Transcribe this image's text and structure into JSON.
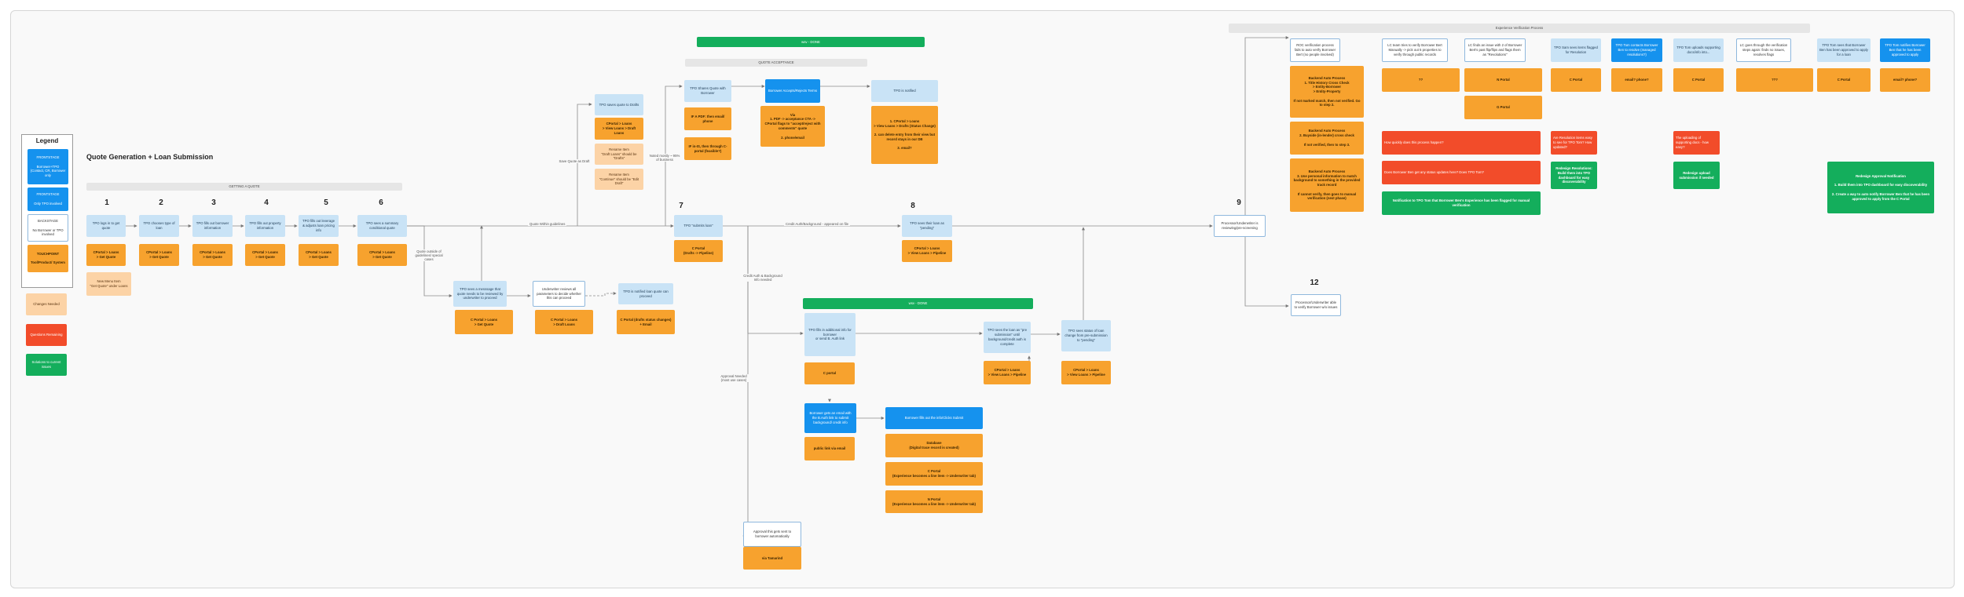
{
  "legend": {
    "title": "Legend",
    "items": [
      {
        "label": "FRONTSTAGE\n\nBorrower+TPO (Contact, CR, Borrower only"
      },
      {
        "label": "FRONTSTAGE\n\nOnly TPO involved"
      },
      {
        "label": "BACKSTAGE\n\nNo Borrower or TPO involved"
      },
      {
        "label": "TOUCHPOINT\n\nTool/Product/ System"
      },
      {
        "label": "Changes Needed"
      },
      {
        "label": "Questions Remaining"
      },
      {
        "label": "Solutions to current issues"
      }
    ]
  },
  "colors": {
    "frontstage_both": "#c9e3f6",
    "frontstage_tpo": "#1592ee",
    "touchpoint": "#f7a22e",
    "changes": "#fcd3a6",
    "questions": "#f24c2a",
    "solutions": "#14ae5c"
  },
  "page_title": "Quote Generation + Loan Submission",
  "sections": {
    "getting_quote": "GETTING A QUOTE",
    "quote_acceptance": "QUOTE ACCEPTANCE",
    "wsv_done_1": "wsv - DONE",
    "wsv_done_2": "wsv - DONE",
    "experience_verification": "Experience Verification Process"
  },
  "steps": {
    "s1": "1",
    "s2": "2",
    "s3": "3",
    "s4": "4",
    "s5": "5",
    "s6": "6",
    "s7": "7",
    "s8": "8",
    "s9": "9",
    "s12": "12"
  },
  "nodes": {
    "tpo_login": "TPO logs in to get quote",
    "tpo_loan_type": "TPO chooses type of loan",
    "tpo_borrower_info": "TPO fills out borrower information",
    "tpo_property_info": "TPO fills out property information",
    "tpo_leverage": "TPO fills out leverage & adjusts loan pricing info",
    "tpo_summary": "TPO sees a summary conditional quote",
    "t1": "CPortal > Loans\n> Get Quote",
    "t2": "CPortal > Loans\n> Get Quote",
    "t3": "CPortal > Loans\n> Get Quote",
    "t4": "CPortal > Loans\n> Get Quote",
    "t5": "CPortal > Loans\n> Get Quote",
    "t6": "CPortal > Loans\n> Get Quote",
    "new_menu": "New Menu Item\n\"Get Quote\" under Loans",
    "tpo_message": "TPO sees a messsage that quote needs to be reviewed by underwriter to proceed",
    "uw_review": "Underwriter reviews all parameters to decide whether this can proceed",
    "tpo_notified": "TPO is notified loan quote can proceed",
    "t_message": "C Portal > Loans\n> Get Quote",
    "t_uw": "C Portal > Loans\n> Draft Loans",
    "t_notified": "C Portal (drafts status changes) + Email",
    "tpo_saves_draft": "TPO saves quote to Drafts",
    "t_draft": "CPortal > Loans\n> View Loans > Draft Loans",
    "rename_drafts": "Rename Item\n\"Draft Loans\" should be \"Drafts\"",
    "rename_edit": "Rename Item\n\"Continue\" should be \"Edit Draft\"",
    "tpo_shares": "TPO Shares Quote with Borrower",
    "t_share_a": "IF A PDF: then email/ phone",
    "t_share_b": "IF in-IS, then through C-portal (feasible?)",
    "borrower_accepts": "Borrower Accepts/Rejects Terms",
    "t_accepts": "Via\n1. PDF -> acceptance CTA ->\nCPortal flags to \"accept/reject with comments\" quote\n\n2. phone/email",
    "tpo_notified_2": "TPO is notified",
    "t_notified_2": "1. CPortal > Loans\n> View Loans > Drafts (Status Change)\n\n2. can delete entry from their view but record stays in our DB\n\n3. email?",
    "tpo_submits": "TPO \"submits loan\"",
    "t_submits": "C Portal\n(Drafts -> Pipeline)",
    "tpo_sees_pending": "TPO sees their loan as \"pending\"",
    "t_pending": "CPortal > Loans\n> View Loans > Pipeline",
    "tpo_fills_additional": "TPO fills in additional info for borrower\nor send B. Auth link",
    "t_additional": "C portal",
    "borrower_email": "Borrower gets an email with the B.Auth link to submit background/ credit info",
    "t_email": "public link via email",
    "borrower_submit": "Borrower fills out the info/Clicks Submit",
    "t_salesforce": "Database\n(Digital trace record is created)",
    "t_cportal_exp": "C Portal\n(Experience becomes a line item -> Underwriter tab)",
    "t_nportal_exp": "N Portal\n(Experience becomes a line item -> Underwriter tab)",
    "tpo_sees_loan": "TPO sees the loan as \"pre submission\" until background/credit auth is complete",
    "t_sees_loan": "CPortal > Loans\n> View Loans > Pipeline",
    "tpo_status_change": "TPO sees status of loan change from pre-submission to \"pending\"",
    "t_status_change": "CPortal > Loans\n> View Loans > Pipeline",
    "approval_sent": "Approval this gets sent to borrower automatically",
    "t_approval": "via Tamarind",
    "processor_review": "Processor/Underwriter is reviewing/pre-screening",
    "processor_verify": "Processor/Underwriter able to verify Borrower w/o issues",
    "ev_col1": "ROC verification process fails to auto verify Borrower Bert (no people involved)",
    "ev_col2": "LC team tries to verify Borrower Bert Manually -> pick out 5 properties to verify through public records",
    "ev_col3": "LC finds an issue with 2 of Borrower Bert's past flip/flips and flags them as \"Revolutions\"",
    "ev_col4": "TPO Sam sees items flagged for Resolution",
    "ev_col5": "TPO Tom contacts Borrower Ben to resolve (managed resolutions?)",
    "ev_col6": "TPO Tom uploads supporting docs/info into...",
    "ev_col7": "LC goes through the verification steps again: finds no issues, resolves flags",
    "ev_col8": "TPO Tom sees that Borrower Ben has been approved to apply for a loan",
    "ev_col9": "TPO Tom notifies Borrower Ben that he has been approved to apply",
    "bp1": "Backend Auto Process\n1. Title History Cross Check\n  > Entity-Borrower\n  > Entity-Property\n\nIf not marked match, then not verified. Go to step 2.",
    "bp2": "Backend Auto Process\n2. Buyside (in-lender) cross check\n\nIf not verified, then to step 3.",
    "bp3": "Backend Auto Process\n3. Use personal information to match background to something in the provided track record\n\nIf cannot verify, then goes to manual verification (next phase)",
    "ev_t2": "??",
    "ev_t3a": "N Portal",
    "ev_t3b": "G Portal",
    "ev_t4": "C Portal",
    "ev_t5": "email? phone?",
    "ev_t6": "C Portal",
    "ev_t7": "???",
    "ev_t8": "C Portal",
    "ev_t9": "email? phone?",
    "q1": "How quickly does this process happen?",
    "q2": "Does Borrower Ben get any status updates here? Does TPO Tom?",
    "q3": "Are Resolution items easy to see for TPO Tom? How updated?",
    "q4": "The uploading of supporting docs - how easy?",
    "sol1": "Notification to TPO Tom that Borrower Ben's Experience has been flagged for manual verification",
    "sol2": "Redesign Resolutions: Build them into TPO dashboard for easy discoverability",
    "sol3": "Redesign upload submission if needed",
    "sol4": "Redesign Approval Notification\n\n1. Build them into TPO dashboard for easy discoverability\n\n2. Create a way to auto notify Borrower Ben that he has been approved to apply from the C Portal"
  },
  "edge_labels": {
    "guidelines": "Quote Within guidelines",
    "outside": "Quote outside of guidelines/ special cases",
    "save_draft": "Save Quote as Draft",
    "notice": "Noted mostly ~ 95% of business",
    "credit_on_file": "Credit Auth/Background - appeared on file",
    "credit_needed": "Credit Auth & Background Info needed",
    "approval_needed": "Approval Needed\n(most use cases)"
  }
}
